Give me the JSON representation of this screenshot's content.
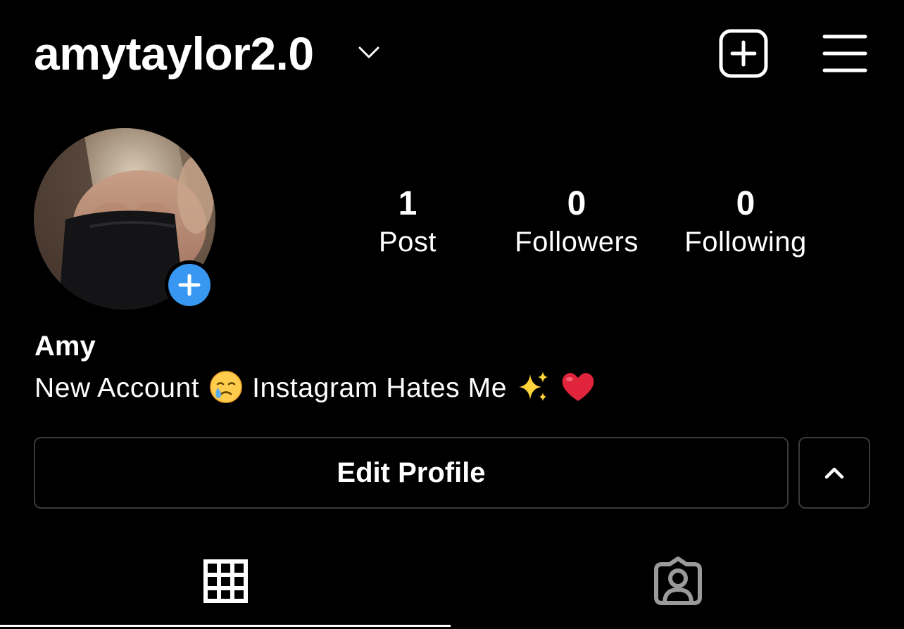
{
  "header": {
    "username": "amytaylor2.0",
    "username_menu_icon": "chevron-down-icon",
    "new_post_icon": "plus-square-icon",
    "menu_icon": "hamburger-menu-icon"
  },
  "profile": {
    "avatar": "profile-photo",
    "add_story_icon": "plus-icon",
    "display_name": "Amy",
    "bio": {
      "text_1": "New Account",
      "emoji_1": "crying-face-emoji",
      "text_2": "Instagram Hates Me",
      "emoji_2": "sparkles-emoji",
      "emoji_3": "red-heart-emoji"
    }
  },
  "stats": {
    "posts": {
      "count": "1",
      "label": "Post"
    },
    "followers": {
      "count": "0",
      "label": "Followers"
    },
    "following": {
      "count": "0",
      "label": "Following"
    }
  },
  "actions": {
    "edit_profile_label": "Edit Profile",
    "suggestions_icon": "chevron-up-icon"
  },
  "tabs": {
    "grid_icon": "grid-icon",
    "tagged_icon": "tagged-person-icon",
    "active": "grid"
  },
  "colors": {
    "background": "#000000",
    "text": "#ffffff",
    "accent_blue": "#3897f0",
    "button_border": "#3a3a3a",
    "heart_red": "#e0243b",
    "sparkle_yellow": "#ffd43b"
  }
}
